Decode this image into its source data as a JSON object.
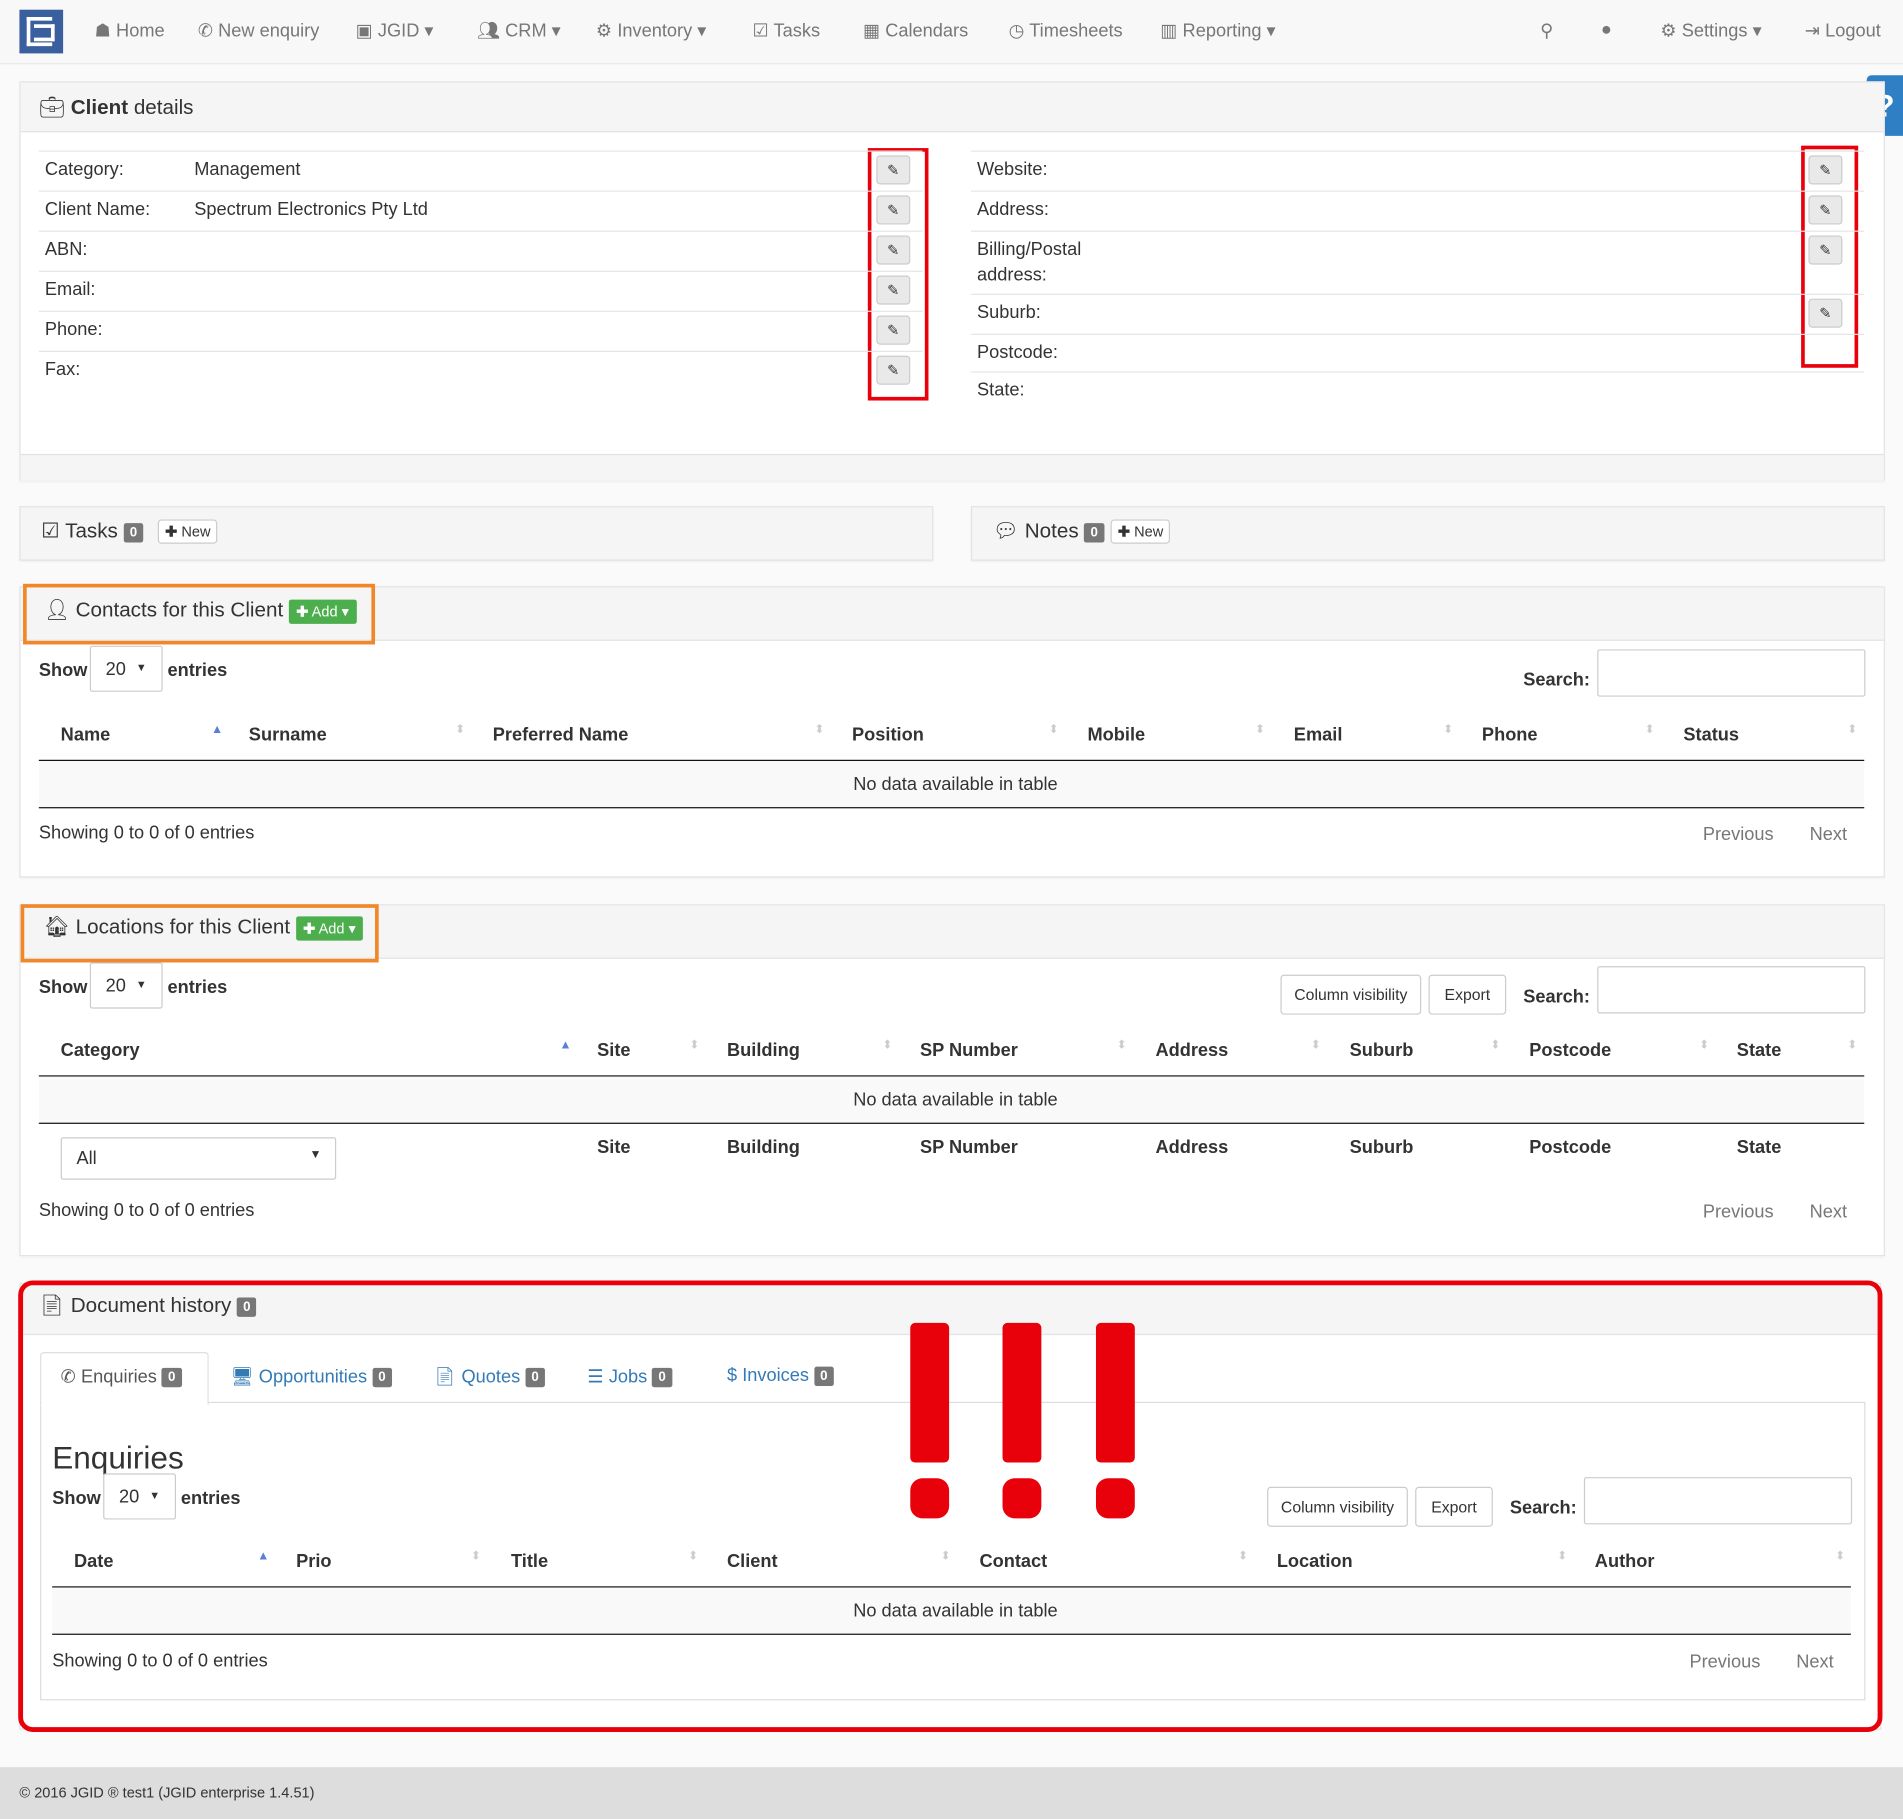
{
  "nav": {
    "items": [
      {
        "icon": "home-icon",
        "label": "Home"
      },
      {
        "icon": "phone-icon",
        "label": "New enquiry"
      },
      {
        "icon": "jgid-icon",
        "label": "JGID ▾"
      },
      {
        "icon": "users-icon",
        "label": "CRM ▾"
      },
      {
        "icon": "cubes-icon",
        "label": "Inventory ▾"
      },
      {
        "icon": "check-square-icon",
        "label": "Tasks"
      },
      {
        "icon": "calendar-icon",
        "label": "Calendars"
      },
      {
        "icon": "clock-icon",
        "label": "Timesheets"
      },
      {
        "icon": "bar-chart-icon",
        "label": "Reporting ▾"
      }
    ],
    "settings": "Settings ▾",
    "logout": "Logout",
    "help": "?"
  },
  "client": {
    "title_bold": "Client",
    "title_rest": " details",
    "left": [
      {
        "label": "Category:",
        "value": "Management"
      },
      {
        "label": "Client Name:",
        "value": "Spectrum Electronics Pty Ltd"
      },
      {
        "label": "ABN:",
        "value": ""
      },
      {
        "label": "Email:",
        "value": ""
      },
      {
        "label": "Phone:",
        "value": ""
      },
      {
        "label": "Fax:",
        "value": ""
      }
    ],
    "right": [
      {
        "label": "Website:"
      },
      {
        "label": "Address:"
      },
      {
        "label": "Billing/Postal"
      },
      {
        "label": "address:"
      },
      {
        "label": "Suburb:"
      },
      {
        "label": "Postcode:"
      },
      {
        "label": "State:"
      }
    ]
  },
  "tasks": {
    "title": "Tasks",
    "count": "0",
    "new": "New"
  },
  "notes": {
    "title": "Notes",
    "count": "0",
    "new": "New"
  },
  "common": {
    "show": "Show",
    "entries": "entries",
    "page_size": "20",
    "search": "Search:",
    "no_data": "No data available in table",
    "showing": "Showing 0 to 0 of 0 entries",
    "previous": "Previous",
    "next": "Next",
    "col_vis": "Column visibility",
    "export": "Export",
    "add": "Add ▾"
  },
  "contacts": {
    "title": "Contacts for this Client",
    "columns": [
      "Name",
      "Surname",
      "Preferred Name",
      "Position",
      "Mobile",
      "Email",
      "Phone",
      "Status"
    ]
  },
  "locations": {
    "title": "Locations for this Client",
    "columns": [
      "Category",
      "Site",
      "Building",
      "SP Number",
      "Address",
      "Suburb",
      "Postcode",
      "State"
    ],
    "filter_value": "All",
    "footer_columns": [
      "Site",
      "Building",
      "SP Number",
      "Address",
      "Suburb",
      "Postcode",
      "State"
    ]
  },
  "docs": {
    "title": "Document history",
    "count": "0",
    "tabs": [
      {
        "label": "Enquiries",
        "count": "0"
      },
      {
        "label": "Opportunities",
        "count": "0"
      },
      {
        "label": "Quotes",
        "count": "0"
      },
      {
        "label": "Jobs",
        "count": "0"
      },
      {
        "label": "Invoices",
        "count": "0"
      }
    ],
    "heading": "Enquiries",
    "columns": [
      "Date",
      "Prio",
      "Title",
      "Client",
      "Contact",
      "Location",
      "Author"
    ]
  },
  "footer": "© 2016 JGID ® test1 (JGID enterprise 1.4.51)",
  "colors": {
    "annotation_red": "#e8000b",
    "annotation_orange": "#f0882a",
    "add_green": "#4cae4c",
    "brand_blue": "#3a5f9e"
  }
}
